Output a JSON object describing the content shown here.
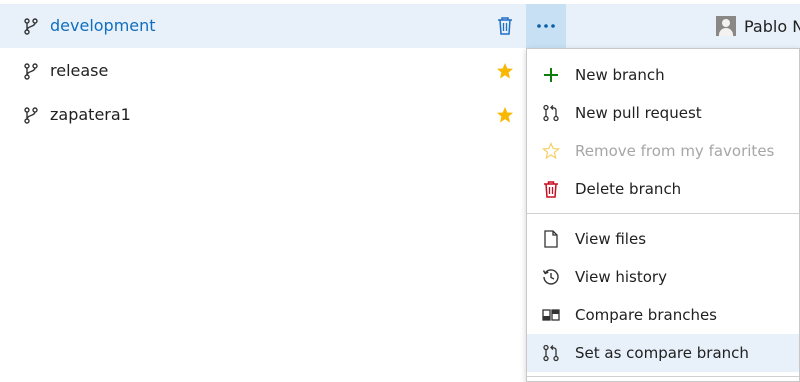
{
  "branches": [
    {
      "name": "development",
      "selected": true,
      "favorite": false
    },
    {
      "name": "release",
      "selected": false,
      "favorite": true
    },
    {
      "name": "zapatera1",
      "selected": false,
      "favorite": true
    }
  ],
  "author_name": "Pablo N",
  "menu": {
    "items": [
      {
        "label": "New branch",
        "icon": "plus-icon"
      },
      {
        "label": "New pull request",
        "icon": "pull-request-icon"
      },
      {
        "label": "Remove from my favorites",
        "icon": "star-outline-icon",
        "disabled": true
      },
      {
        "label": "Delete branch",
        "icon": "trash-icon"
      },
      {
        "label": "View files",
        "icon": "file-icon"
      },
      {
        "label": "View history",
        "icon": "history-icon"
      },
      {
        "label": "Compare branches",
        "icon": "compare-icon"
      },
      {
        "label": "Set as compare branch",
        "icon": "pull-request-icon",
        "hover": true
      }
    ]
  },
  "colors": {
    "selected_row": "#e8f1fa",
    "selected_text": "#106ebe",
    "more_button": "#c7e0f4",
    "star": "#f8b800",
    "plus": "#107c10",
    "delete": "#c50f1f",
    "trash_blue": "#1f6fc4"
  }
}
